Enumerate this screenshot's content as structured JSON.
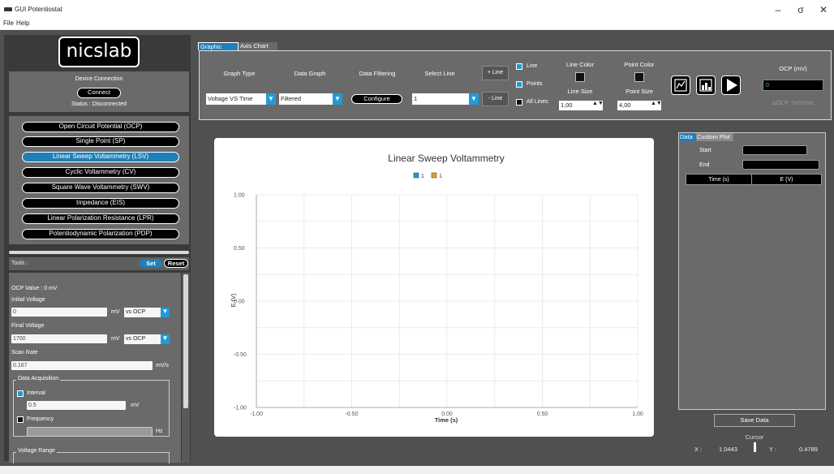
{
  "window": {
    "title": "GUI Potentiostat",
    "minimize": "–",
    "maximize": "σ",
    "close": "✕"
  },
  "menu": [
    "File",
    "Help"
  ],
  "left": {
    "logo": "nicslab",
    "device_connection_title": "Device Connection",
    "connect_label": "Connect",
    "status": "Status : Disconnected",
    "techniques": [
      "Open Circuit Potential (OCP)",
      "Single Point (SP)",
      "Linear Sweep Voltammetry (LSV)",
      "Cyclic Voltammetry (CV)",
      "Square Wave Voltammetry (SWV)",
      "Impedance (EIS)",
      "Linear Polarization Resistance (LPR)",
      "Potentiodynamic Polarization (PDP)"
    ],
    "active_technique_index": 2,
    "tools_label": "Tools :",
    "set_label": "Set",
    "reset_label": "Reset",
    "params": {
      "ocp_value": "OCP Value :    0 mV",
      "initial_voltage_label": "Initial Voltage",
      "initial_voltage": "0",
      "initial_voltage_unit": "mV",
      "initial_ref": "vs OCP",
      "final_voltage_label": "Final Voltage",
      "final_voltage": "1700",
      "final_voltage_unit": "mV",
      "final_ref": "vs OCP",
      "scan_rate_label": "Scan Rate",
      "scan_rate": "0.167",
      "scan_rate_unit": "mV/s",
      "data_acq_label": "Data Acquisition",
      "interval_label": "Interval",
      "interval_value": "0.5",
      "interval_unit": "mV",
      "frequency_label": "Frequency",
      "frequency_unit": "Hz",
      "voltage_range_label": "Voltage Range"
    }
  },
  "top": {
    "tabs": [
      "Graphic Chart",
      "Axis Chart"
    ],
    "graph_type_label": "Graph Type",
    "graph_type": "Voltage VS Time",
    "data_graph_label": "Data Graph",
    "data_graph": "Filtered",
    "data_filtering_label": "Data Filtering",
    "configure_label": "Configure",
    "select_line_label": "Select Line",
    "select_line": "1",
    "add_line": "+ Line",
    "remove_line": "- Line",
    "line_check": "Line",
    "points_check": "Points",
    "all_lines_check": "All Lines",
    "line_color_label": "Line Color",
    "point_color_label": "Point Color",
    "line_size_label": "Line Size",
    "line_size": "1,00",
    "point_size_label": "Point Size",
    "point_size": "4,00",
    "ocp_label": "OCP (mV)",
    "ocp_value": "0",
    "delta_ocp": "ΔOCP: 0mV/min"
  },
  "chart_data": {
    "type": "line",
    "title": "Linear Sweep Voltammetry",
    "xlabel": "Time (s)",
    "ylabel": "E (V)",
    "xlim": [
      -1.0,
      1.0
    ],
    "ylim": [
      -1.0,
      1.0
    ],
    "xticks": [
      "-1.00",
      "-0.50",
      "0.00",
      "0.50",
      "1.00"
    ],
    "yticks": [
      "1.00",
      "0.50",
      "0.00",
      "-0.50",
      "-1.00"
    ],
    "grid": true,
    "legend_position": "top-center",
    "series": [
      {
        "name": "1",
        "color": "#1f9bd9",
        "values": []
      },
      {
        "name": "1",
        "color": "#e8a020",
        "values": []
      }
    ]
  },
  "right": {
    "tabs": [
      "Data",
      "Custom Plot"
    ],
    "start_label": "Start",
    "end_label": "End",
    "col_time": "Time (s)",
    "col_e": "E (V)",
    "save_label": "Save Data",
    "cursor_label": "Cursor",
    "x_label": "X :",
    "x_value": "1.0443",
    "y_label": "Y :",
    "y_value": "0.4789"
  },
  "colors": {
    "accent": "#1f7fb8",
    "panel": "#6a6a6a",
    "workspace": "#505050",
    "ocp_text": "#2fd42f"
  }
}
